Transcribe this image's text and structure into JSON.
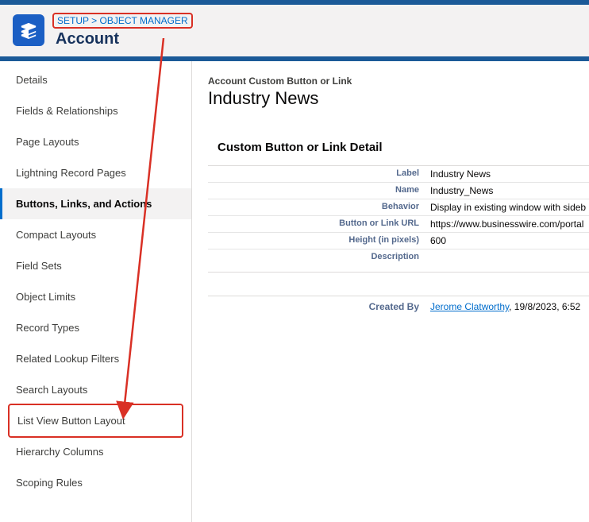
{
  "breadcrumb": {
    "setup": "SETUP",
    "sep": ">",
    "objectManager": "OBJECT MANAGER"
  },
  "pageTitle": "Account",
  "sidebar": {
    "items": [
      {
        "label": "Details"
      },
      {
        "label": "Fields & Relationships"
      },
      {
        "label": "Page Layouts"
      },
      {
        "label": "Lightning Record Pages"
      },
      {
        "label": "Buttons, Links, and Actions"
      },
      {
        "label": "Compact Layouts"
      },
      {
        "label": "Field Sets"
      },
      {
        "label": "Object Limits"
      },
      {
        "label": "Record Types"
      },
      {
        "label": "Related Lookup Filters"
      },
      {
        "label": "Search Layouts"
      },
      {
        "label": "List View Button Layout"
      },
      {
        "label": "Hierarchy Columns"
      },
      {
        "label": "Scoping Rules"
      }
    ]
  },
  "main": {
    "subhead": "Account Custom Button or Link",
    "title": "Industry News",
    "sectionTitle": "Custom Button or Link Detail",
    "rows": [
      {
        "label": "Label",
        "value": "Industry News"
      },
      {
        "label": "Name",
        "value": "Industry_News"
      },
      {
        "label": "Behavior",
        "value": "Display in existing window with sideb"
      },
      {
        "label": "Button or Link URL",
        "value": "https://www.businesswire.com/portal"
      },
      {
        "label": "Height (in pixels)",
        "value": "600"
      },
      {
        "label": "Description",
        "value": ""
      }
    ],
    "createdBy": {
      "label": "Created By",
      "name": "Jerome Clatworthy",
      "date": ", 19/8/2023, 6:52"
    }
  }
}
